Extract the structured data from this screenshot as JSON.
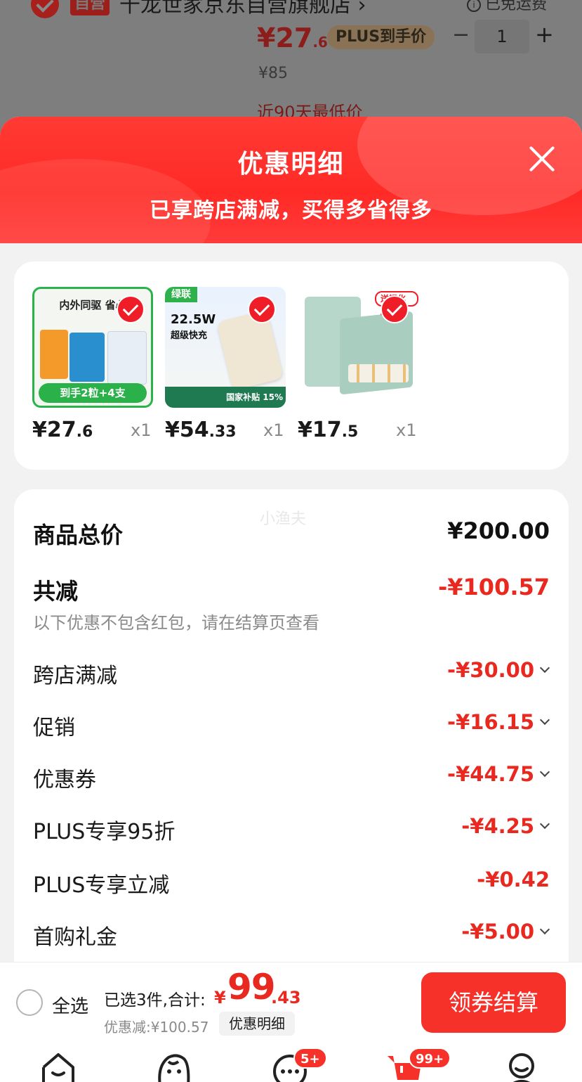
{
  "background_cart": {
    "tag": "自营",
    "shop_name": "千龙世家京东自营旗舰店",
    "shipping": "已免运费",
    "price_main": "¥27",
    "price_dec": ".6",
    "plus_label": "PLUS到手价",
    "quantity": "1",
    "original_price": "¥85",
    "lowest_note": "近90天最低价"
  },
  "modal": {
    "title": "优惠明细",
    "subtitle": "已享跨店满减，买得多省得多"
  },
  "products": [
    {
      "price_main": "¥27",
      "price_dec": ".6",
      "qty": "x1",
      "thumb": {
        "headline": "内外同驱 省心",
        "footer": "到手2粒+4支"
      }
    },
    {
      "price_main": "¥54",
      "price_dec": ".33",
      "qty": "x1",
      "thumb": {
        "brand": "绿联",
        "headline": "22.5W",
        "sub": "超级快充",
        "footer": "国家补贴 15%"
      }
    },
    {
      "price_main": "¥17",
      "price_dec": ".5",
      "qty": "x1",
      "thumb": {
        "gift": "送钢化膜"
      }
    }
  ],
  "details": {
    "watermark": "小渔夫",
    "total_label": "商品总价",
    "total_value": "¥200.00",
    "reduce_label": "共减",
    "reduce_value": "-¥100.57",
    "reduce_note": "以下优惠不包含红包，请在结算页查看",
    "items": [
      {
        "label": "跨店满减",
        "value": "-¥30.00",
        "expandable": true
      },
      {
        "label": "促销",
        "value": "-¥16.15",
        "expandable": true
      },
      {
        "label": "优惠券",
        "value": "-¥44.75",
        "expandable": true
      },
      {
        "label": "PLUS专享95折",
        "value": "-¥4.25",
        "expandable": true
      },
      {
        "label": "PLUS专享立减",
        "value": "-¥0.42",
        "expandable": false
      },
      {
        "label": "首购礼金",
        "value": "-¥5.00",
        "expandable": true
      }
    ]
  },
  "checkout": {
    "select_all": "全选",
    "summary": "已选3件,合计:",
    "currency": "¥",
    "total_main": "99",
    "total_dec": ".43",
    "saved": "优惠减:¥100.57",
    "detail_button": "优惠明细",
    "pay_button": "领券结算"
  },
  "tabbar": {
    "messages_badge": "5+",
    "cart_badge": "99+"
  },
  "colors": {
    "accent_red": "#f5312a",
    "price_red": "#e9281f",
    "header_red": "#ff2a26",
    "check_green": "#29b34a"
  }
}
